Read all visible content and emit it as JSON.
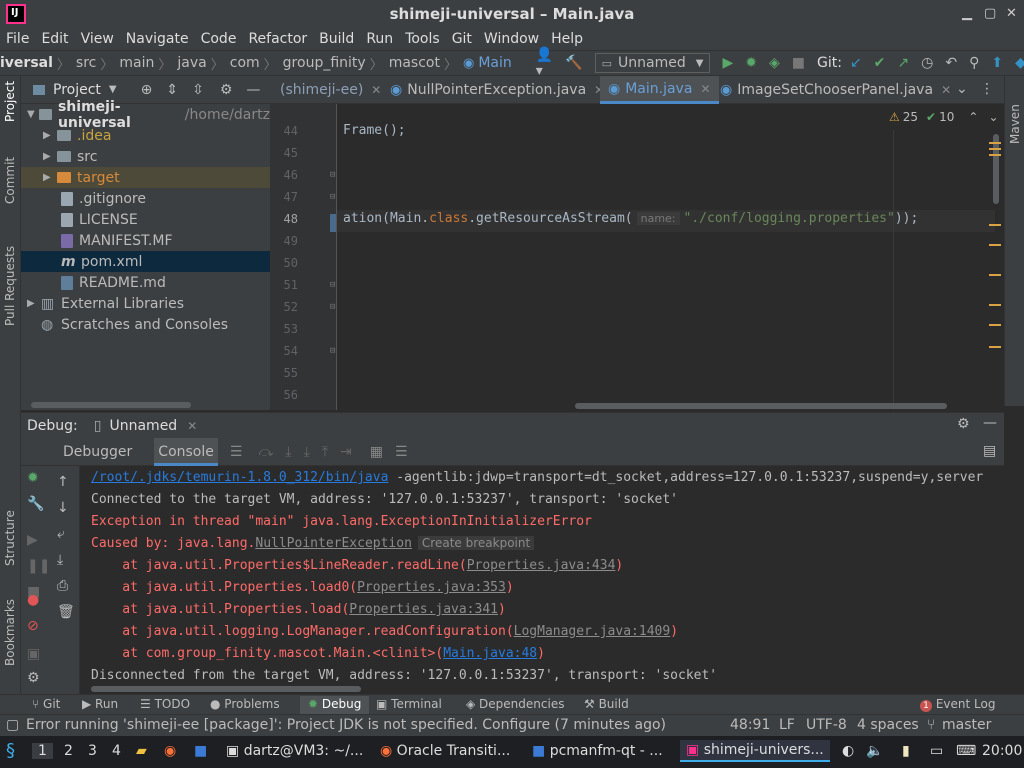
{
  "window": {
    "title": "shimeji-universal – Main.java",
    "app_icon_label": "IJ"
  },
  "menu": [
    "File",
    "Edit",
    "View",
    "Navigate",
    "Code",
    "Refactor",
    "Build",
    "Run",
    "Tools",
    "Git",
    "Window",
    "Help"
  ],
  "breadcrumbs": [
    "iversal",
    "src",
    "main",
    "java",
    "com",
    "group_finity",
    "mascot",
    "Main"
  ],
  "run_config": "Unnamed",
  "git_label": "Git:",
  "left_stripe": [
    "Project",
    "Commit",
    "Pull Requests",
    "Structure",
    "Bookmarks"
  ],
  "right_stripe": [
    "Maven"
  ],
  "project_panel": {
    "title": "Project",
    "items": [
      {
        "label": "shimeji-universal",
        "suffix": "/home/dartz",
        "level": 0,
        "expanded": true,
        "kind": "module"
      },
      {
        "label": ".idea",
        "level": 1,
        "expanded": false,
        "kind": "folder",
        "color": "#c8a33d"
      },
      {
        "label": "src",
        "level": 1,
        "expanded": false,
        "kind": "folder",
        "color": "#87939a"
      },
      {
        "label": "target",
        "level": 1,
        "expanded": false,
        "kind": "folder",
        "color": "#d78a3b"
      },
      {
        "label": ".gitignore",
        "level": 1,
        "kind": "file"
      },
      {
        "label": "LICENSE",
        "level": 1,
        "kind": "file"
      },
      {
        "label": "MANIFEST.MF",
        "level": 1,
        "kind": "file"
      },
      {
        "label": "pom.xml",
        "level": 1,
        "kind": "file",
        "selected": true
      },
      {
        "label": "README.md",
        "level": 1,
        "kind": "file"
      },
      {
        "label": "External Libraries",
        "level": 0,
        "expanded": false,
        "kind": "lib"
      },
      {
        "label": "Scratches and Consoles",
        "level": 0,
        "kind": "scratch"
      }
    ]
  },
  "editor_tabs": [
    {
      "label": "(shimeji-ee)",
      "active": false
    },
    {
      "label": "NullPointerException.java",
      "active": false
    },
    {
      "label": "Main.java",
      "active": true
    },
    {
      "label": "ImageSetChooserPanel.java",
      "active": false
    }
  ],
  "inspections": {
    "warnings": "25",
    "ok": "10"
  },
  "editor": {
    "lines": [
      "44",
      "45",
      "46",
      "47",
      "48",
      "49",
      "50",
      "51",
      "52",
      "53",
      "54",
      "55",
      "56"
    ],
    "code_44": "Frame();",
    "code_48_a": "ation(Main.",
    "code_48_b": "class",
    "code_48_c": ".getResourceAsStream(",
    "code_48_hint": "name:",
    "code_48_str": "\"./conf/logging.properties\"",
    "code_48_end": "));"
  },
  "debug": {
    "label": "Debug:",
    "config": "Unnamed",
    "tabs": [
      "Debugger",
      "Console"
    ],
    "console": {
      "l1_link": "/root/.jdks/temurin-1.8.0_312/bin/java",
      "l1_rest": " -agentlib:jdwp=transport=dt_socket,address=127.0.0.1:53237,suspend=y,server",
      "l2": "Connected to the target VM, address: '127.0.0.1:53237', transport: 'socket'",
      "l3": "Exception in thread \"main\" java.lang.ExceptionInInitializerError",
      "l4_a": "Caused by: java.lang.",
      "l4_link": "NullPointerException",
      "l4_hint": "Create breakpoint",
      "l5_a": "    at java.util.Properties$LineReader.readLine(",
      "l5_link": "Properties.java:434",
      "l5_b": ")",
      "l6_a": "    at java.util.Properties.load0(",
      "l6_link": "Properties.java:353",
      "l6_b": ")",
      "l7_a": "    at java.util.Properties.load(",
      "l7_link": "Properties.java:341",
      "l7_b": ")",
      "l8_a": "    at java.util.logging.LogManager.readConfiguration(",
      "l8_link": "LogManager.java:1409",
      "l8_b": ")",
      "l9_a": "    at com.group_finity.mascot.Main.<clinit>(",
      "l9_link": "Main.java:48",
      "l9_b": ")",
      "l10": "Disconnected from the target VM, address: '127.0.0.1:53237', transport: 'socket'"
    }
  },
  "tool_windows": [
    "Git",
    "Run",
    "TODO",
    "Problems",
    "Debug",
    "Terminal",
    "Dependencies",
    "Build"
  ],
  "event_log": {
    "count": "1",
    "label": "Event Log"
  },
  "status": {
    "message": "Error running 'shimeji-ee [package]': Project JDK is not specified. Configure (7 minutes ago)",
    "position": "48:91",
    "line_sep": "LF",
    "encoding": "UTF-8",
    "indent": "4 spaces",
    "branch": "master"
  },
  "taskbar": {
    "workspaces": [
      "1",
      "2",
      "3",
      "4"
    ],
    "tasks": [
      "dartz@VM3: ~/...",
      "Oracle Transiti...",
      "pcmanfm-qt - ...",
      "shimeji-univers..."
    ],
    "clock": "20:00"
  }
}
